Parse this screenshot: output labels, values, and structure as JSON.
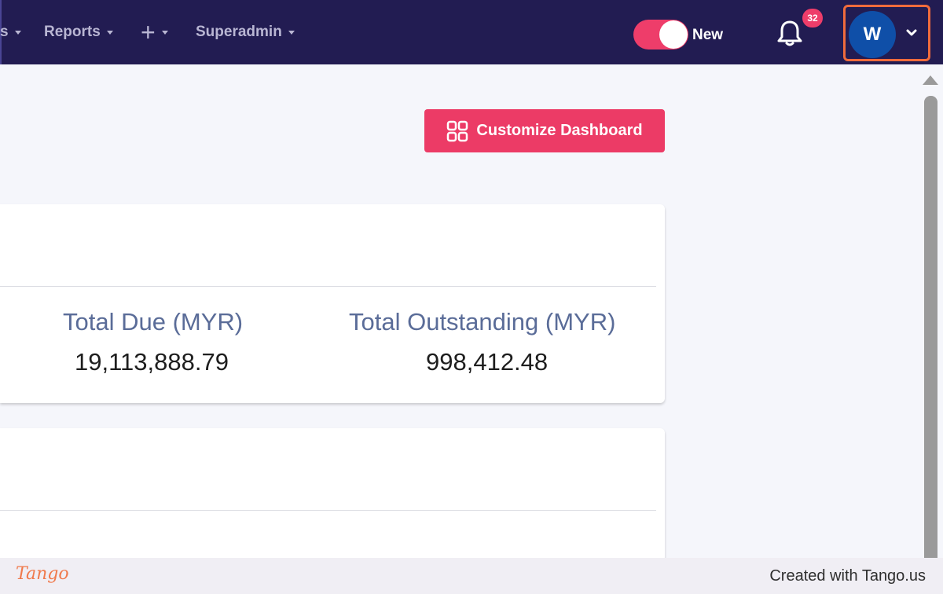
{
  "nav": {
    "items": [
      {
        "label": "s"
      },
      {
        "label": "Reports"
      },
      {
        "label": "+"
      },
      {
        "label": "Superadmin"
      }
    ],
    "toggle_label": "New",
    "notification_count": "32",
    "avatar_initial": "W"
  },
  "toolbar": {
    "customize_label": "Customize Dashboard"
  },
  "summary": {
    "stats": [
      {
        "label": "Total Due (MYR)",
        "value": "19,113,888.79"
      },
      {
        "label": "Total Outstanding (MYR)",
        "value": "998,412.48"
      }
    ]
  },
  "footer": {
    "logo_text": "Tango",
    "created_text": "Created with Tango.us"
  },
  "colors": {
    "nav_bg": "#221c52",
    "accent": "#ec3b66",
    "highlight": "#f06b3c",
    "avatar_bg": "#0f4fa8"
  }
}
